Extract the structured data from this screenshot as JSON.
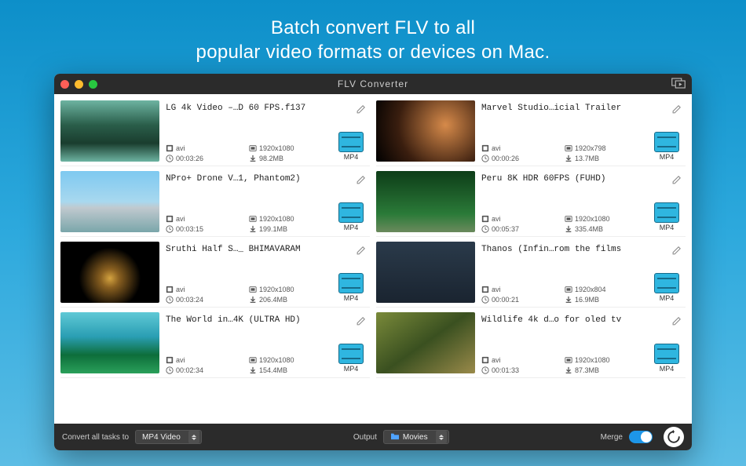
{
  "headline": "Batch convert FLV to all\npopular video formats or devices on Mac.",
  "window": {
    "title": "FLV Converter"
  },
  "videos": [
    {
      "title": "LG 4k Video –…D 60 FPS.f137",
      "format": "avi",
      "resolution": "1920x1080",
      "duration": "00:03:26",
      "size": "98.2MB",
      "outFormat": "MP4"
    },
    {
      "title": "Marvel Studio…icial Trailer",
      "format": "avi",
      "resolution": "1920x798",
      "duration": "00:00:26",
      "size": "13.7MB",
      "outFormat": "MP4"
    },
    {
      "title": "NPro+ Drone V…1, Phantom2)",
      "format": "avi",
      "resolution": "1920x1080",
      "duration": "00:03:15",
      "size": "199.1MB",
      "outFormat": "MP4"
    },
    {
      "title": "Peru 8K HDR 60FPS (FUHD)",
      "format": "avi",
      "resolution": "1920x1080",
      "duration": "00:05:37",
      "size": "335.4MB",
      "outFormat": "MP4"
    },
    {
      "title": "Sruthi Half S…_ BHIMAVARAM",
      "format": "avi",
      "resolution": "1920x1080",
      "duration": "00:03:24",
      "size": "206.4MB",
      "outFormat": "MP4"
    },
    {
      "title": "Thanos (Infin…rom the films",
      "format": "avi",
      "resolution": "1920x804",
      "duration": "00:00:21",
      "size": "16.9MB",
      "outFormat": "MP4"
    },
    {
      "title": "The World in…4K (ULTRA HD)",
      "format": "avi",
      "resolution": "1920x1080",
      "duration": "00:02:34",
      "size": "154.4MB",
      "outFormat": "MP4"
    },
    {
      "title": "Wildlife 4k d…o for oled tv",
      "format": "avi",
      "resolution": "1920x1080",
      "duration": "00:01:33",
      "size": "87.3MB",
      "outFormat": "MP4"
    }
  ],
  "footer": {
    "convertAllLabel": "Convert all tasks to",
    "convertAllValue": "MP4 Video",
    "outputLabel": "Output",
    "outputValue": "Movies",
    "mergeLabel": "Merge"
  }
}
